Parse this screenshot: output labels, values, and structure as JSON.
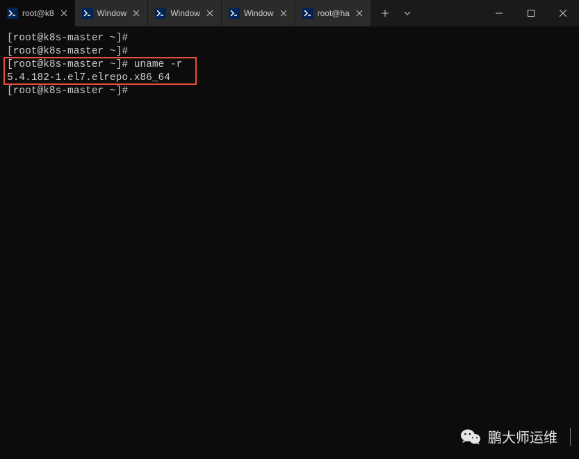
{
  "tabs": [
    {
      "label": "root@k8",
      "active": true
    },
    {
      "label": "Window",
      "active": false
    },
    {
      "label": "Window",
      "active": false
    },
    {
      "label": "Window",
      "active": false
    },
    {
      "label": "root@ha",
      "active": false
    }
  ],
  "terminal": {
    "lines": [
      "[root@k8s-master ~]#",
      "[root@k8s-master ~]#",
      "[root@k8s-master ~]# uname -r",
      "5.4.182-1.el7.elrepo.x86_64",
      "[root@k8s-master ~]#"
    ]
  },
  "watermark": {
    "text": "鹏大师运维"
  }
}
